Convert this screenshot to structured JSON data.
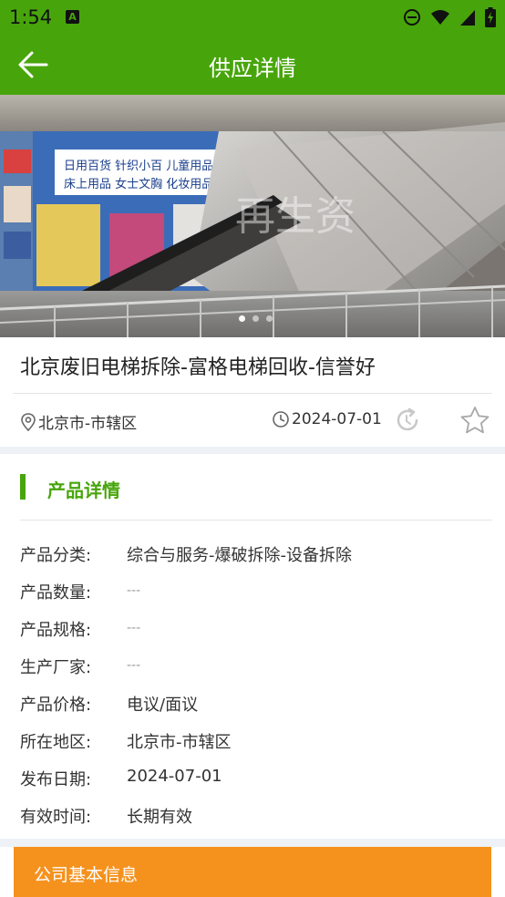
{
  "status_bar": {
    "time": "1:54",
    "notif_letter": "A"
  },
  "app_bar": {
    "title": "供应详情"
  },
  "banner": {
    "sign_line1": "日用百货 针织小百 儿童用品",
    "sign_line2": "床上用品 女士文胸 化妆用品",
    "watermark": "再生资"
  },
  "product": {
    "title": "北京废旧电梯拆除-富格电梯回收-信誉好",
    "location": "北京市-市辖区",
    "date": "2024-07-01"
  },
  "section": {
    "title": "产品详情"
  },
  "details": [
    {
      "label": "产品分类:",
      "value": "综合与服务-爆破拆除-设备拆除"
    },
    {
      "label": "产品数量:",
      "value": "---"
    },
    {
      "label": "产品规格:",
      "value": "---"
    },
    {
      "label": "生产厂家:",
      "value": "---"
    },
    {
      "label": "产品价格:",
      "value": "电议/面议"
    },
    {
      "label": "所在地区:",
      "value": "北京市-市辖区"
    },
    {
      "label": "发布日期:",
      "value": "2024-07-01"
    },
    {
      "label": "有效时间:",
      "value": "长期有效"
    }
  ],
  "company": {
    "label": "公司基本信息"
  },
  "colors": {
    "primary": "#47a50b",
    "accent": "#f5921e"
  }
}
